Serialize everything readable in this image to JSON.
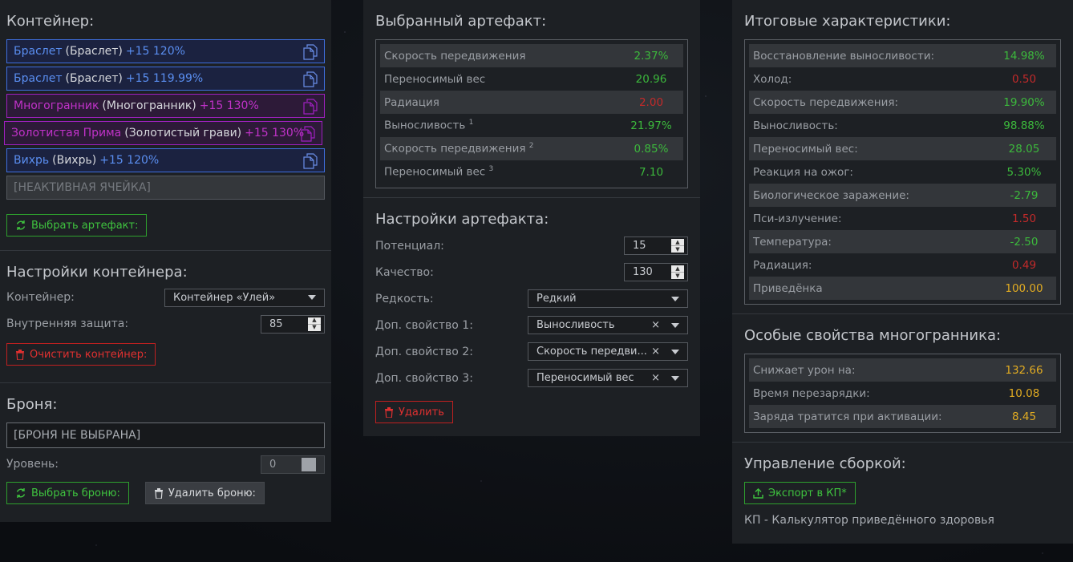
{
  "container": {
    "title": "Контейнер:",
    "slots": [
      {
        "name": "Браслет",
        "base": "(Браслет)",
        "bonus": "+15 120%",
        "color": "blue"
      },
      {
        "name": "Браслет",
        "base": "(Браслет)",
        "bonus": "+15 119.99%",
        "color": "blue"
      },
      {
        "name": "Многогранник",
        "base": "(Многогранник)",
        "bonus": "+15 130%",
        "color": "purple"
      },
      {
        "name": "Золотистая Прима",
        "base": "(Золотистый грави)",
        "bonus": "+15 130%",
        "color": "purple"
      },
      {
        "name": "Вихрь",
        "base": "(Вихрь)",
        "bonus": "+15 120%",
        "color": "blue"
      }
    ],
    "inactive_slot": "[НЕАКТИВНАЯ ЯЧЕЙКА]",
    "choose_button": "Выбрать артефакт:"
  },
  "container_settings": {
    "title": "Настройки контейнера:",
    "container_label": "Контейнер:",
    "container_value": "Контейнер «Улей»",
    "protection_label": "Внутренняя защита:",
    "protection_value": "85",
    "clear_button": "Очистить контейнер:"
  },
  "armor": {
    "title": "Броня:",
    "value": "[БРОНЯ НЕ ВЫБРАНА]",
    "level_label": "Уровень:",
    "level_value": "0",
    "choose_button": "Выбрать броню:",
    "delete_button": "Удалить броню:"
  },
  "selected_artifact": {
    "title": "Выбранный артефакт:",
    "stats": [
      {
        "k": "Скорость передвижения",
        "sup": "",
        "v": "2.37%",
        "c": "g"
      },
      {
        "k": "Переносимый вес",
        "sup": "",
        "v": "20.96",
        "c": "g"
      },
      {
        "k": "Радиация",
        "sup": "",
        "v": "2.00",
        "c": "r"
      },
      {
        "k": "Выносливость",
        "sup": "1",
        "v": "21.97%",
        "c": "g"
      },
      {
        "k": "Скорость передвижения",
        "sup": "2",
        "v": "0.85%",
        "c": "g"
      },
      {
        "k": "Переносимый вес",
        "sup": "3",
        "v": "7.10",
        "c": "g"
      }
    ]
  },
  "artifact_settings": {
    "title": "Настройки артефакта:",
    "potential_label": "Потенциал:",
    "potential_value": "15",
    "quality_label": "Качество:",
    "quality_value": "130",
    "rarity_label": "Редкость:",
    "rarity_value": "Редкий",
    "prop1_label": "Доп. свойство 1:",
    "prop1_value": "Выносливость",
    "prop2_label": "Доп. свойство 2:",
    "prop2_value": "Скорость передви...",
    "prop3_label": "Доп. свойство 3:",
    "prop3_value": "Переносимый вес",
    "clear_x": "×",
    "delete_button": "Удалить"
  },
  "totals": {
    "title": "Итоговые характеристики:",
    "stats": [
      {
        "k": "Восстановление выносливости:",
        "v": "14.98%",
        "c": "g"
      },
      {
        "k": "Холод:",
        "v": "0.50",
        "c": "r"
      },
      {
        "k": "Скорость передвижения:",
        "v": "19.90%",
        "c": "g"
      },
      {
        "k": "Выносливость:",
        "v": "98.88%",
        "c": "g"
      },
      {
        "k": "Переносимый вес:",
        "v": "28.05",
        "c": "g"
      },
      {
        "k": "Реакция на ожог:",
        "v": "5.30%",
        "c": "g"
      },
      {
        "k": "Биологическое заражение:",
        "v": "-2.79",
        "c": "g"
      },
      {
        "k": "Пси-излучение:",
        "v": "1.50",
        "c": "r"
      },
      {
        "k": "Температура:",
        "v": "-2.50",
        "c": "g"
      },
      {
        "k": "Радиация:",
        "v": "0.49",
        "c": "r"
      },
      {
        "k": "Приведёнка",
        "v": "100.00",
        "c": "y"
      }
    ]
  },
  "special": {
    "title": "Особые свойства многогранника:",
    "stats": [
      {
        "k": "Снижает урон на:",
        "v": "132.66",
        "c": "y"
      },
      {
        "k": "Время перезарядки:",
        "v": "10.08",
        "c": "y"
      },
      {
        "k": "Заряда тратится при активации:",
        "v": "8.45",
        "c": "y"
      }
    ]
  },
  "build": {
    "title": "Управление сборкой:",
    "export_button": "Экспорт в КП*",
    "note": "КП - Калькулятор приведённого здоровья"
  },
  "colors": {
    "green": "#3cb93c",
    "red": "#c42a2a",
    "yellow": "#e2ac22",
    "blue": "#5a8ef0",
    "purple": "#c032c8"
  },
  "icons": [
    "copy-icon",
    "refresh-icon",
    "trash-icon",
    "upload-icon",
    "chevron-down-icon"
  ]
}
